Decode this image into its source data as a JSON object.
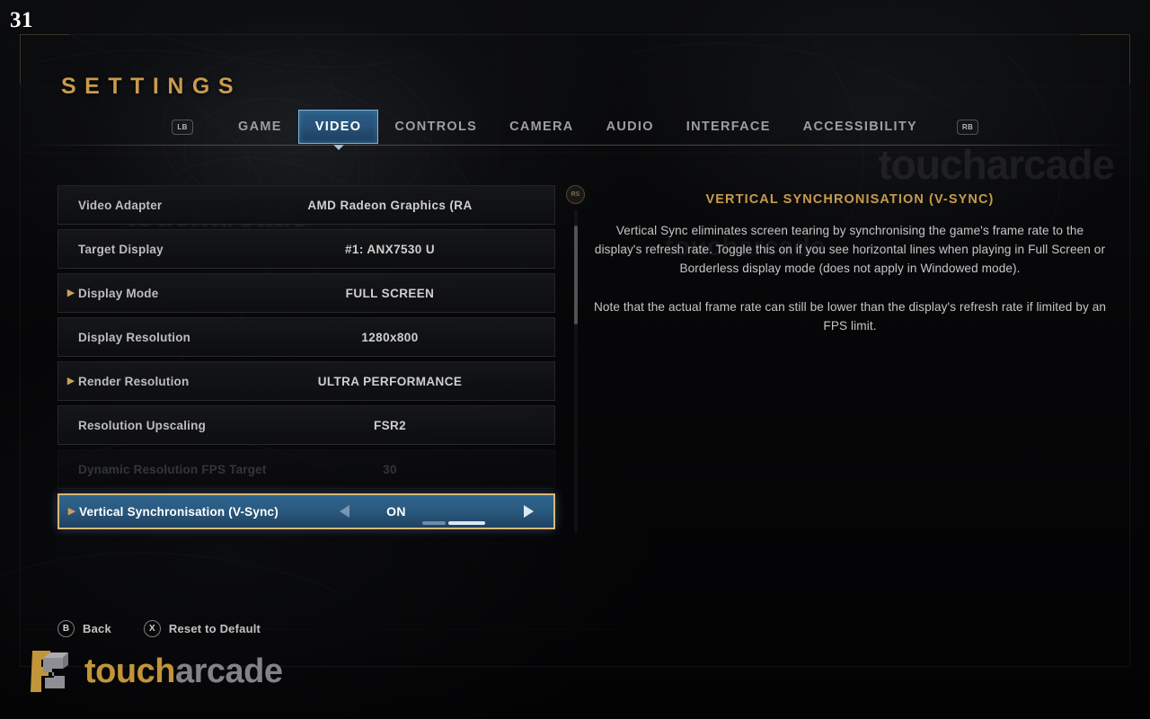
{
  "hud": {
    "fps": "31"
  },
  "header": {
    "title": "SETTINGS"
  },
  "tabs": {
    "bumper_left": "LB",
    "bumper_right": "RB",
    "items": [
      {
        "label": "GAME",
        "active": false
      },
      {
        "label": "VIDEO",
        "active": true
      },
      {
        "label": "CONTROLS",
        "active": false
      },
      {
        "label": "CAMERA",
        "active": false
      },
      {
        "label": "AUDIO",
        "active": false
      },
      {
        "label": "INTERFACE",
        "active": false
      },
      {
        "label": "ACCESSIBILITY",
        "active": false
      }
    ]
  },
  "settings": {
    "rows": [
      {
        "label": "Video Adapter",
        "value": "AMD Radeon Graphics (RA",
        "expandable": false,
        "disabled": false,
        "selected": false
      },
      {
        "label": "Target Display",
        "value": "#1: ANX7530 U",
        "expandable": false,
        "disabled": false,
        "selected": false
      },
      {
        "label": "Display Mode",
        "value": "FULL SCREEN",
        "expandable": true,
        "disabled": false,
        "selected": false
      },
      {
        "label": "Display Resolution",
        "value": "1280x800",
        "expandable": false,
        "disabled": false,
        "selected": false
      },
      {
        "label": "Render Resolution",
        "value": "ULTRA PERFORMANCE",
        "expandable": true,
        "disabled": false,
        "selected": false
      },
      {
        "label": "Resolution Upscaling",
        "value": "FSR2",
        "expandable": false,
        "disabled": false,
        "selected": false
      },
      {
        "label": "Dynamic Resolution FPS Target",
        "value": "30",
        "expandable": false,
        "disabled": true,
        "selected": false
      },
      {
        "label": "Vertical Synchronisation (V-Sync)",
        "value": "ON",
        "expandable": true,
        "disabled": false,
        "selected": true
      }
    ],
    "scroll_badge": "RS"
  },
  "description": {
    "title": "VERTICAL SYNCHRONISATION (V-SYNC)",
    "body": "Vertical Sync eliminates screen tearing by synchronising the game's frame rate to the display's refresh rate.\nToggle this on if you see horizontal lines when playing in Full Screen or Borderless display mode (does not apply in Windowed mode).",
    "note": "Note that the actual frame rate can still be lower than the display's refresh rate if limited by an FPS limit."
  },
  "footer": {
    "actions": [
      {
        "glyph": "B",
        "label": "Back"
      },
      {
        "glyph": "X",
        "label": "Reset to Default"
      }
    ]
  },
  "watermark": {
    "part1": "touch",
    "part2": "arcade"
  },
  "colors": {
    "accent_gold": "#c99a4e",
    "selected_blue": "#2a5a80",
    "selected_border": "#d8b878",
    "tab_active_border": "#7fb4d8"
  }
}
